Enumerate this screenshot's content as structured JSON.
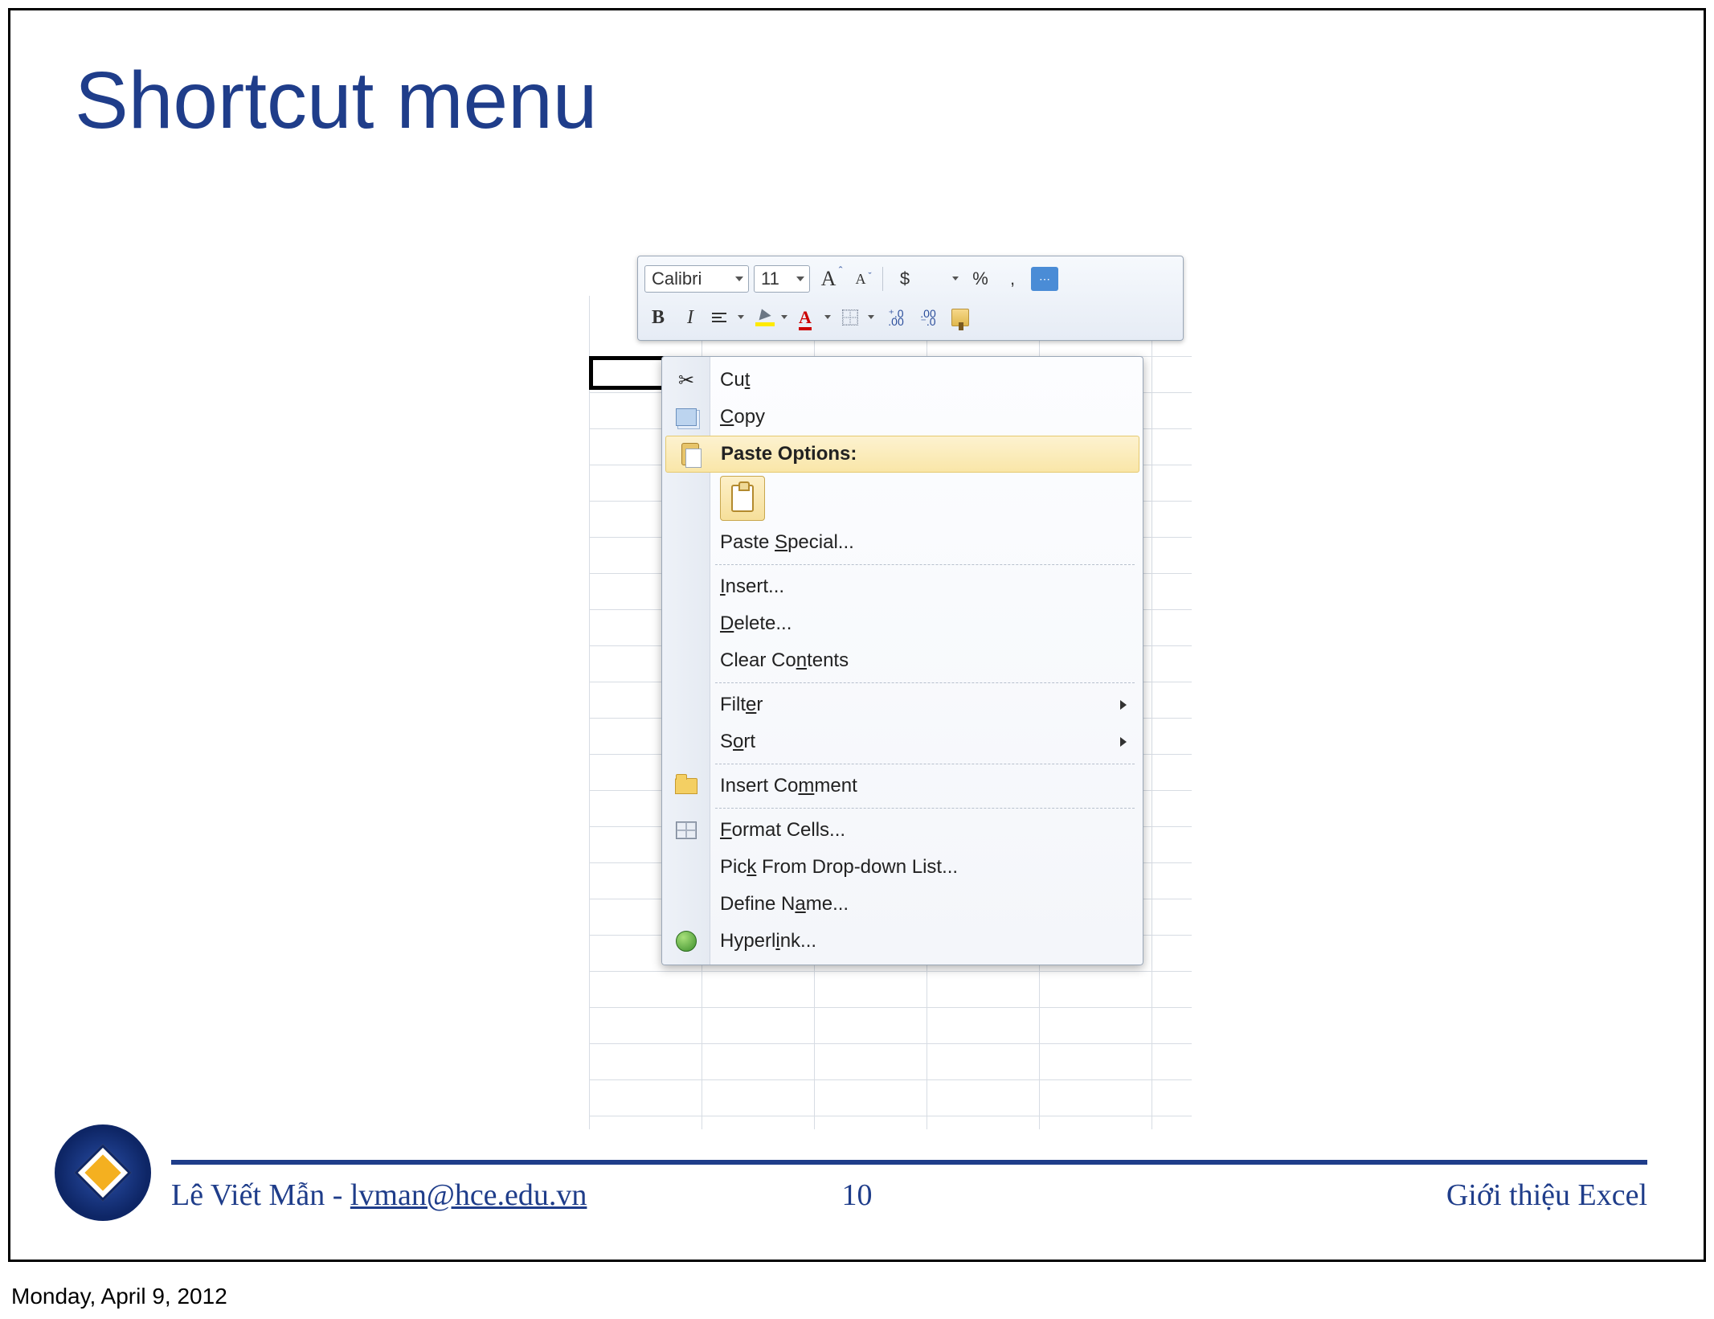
{
  "slide": {
    "title": "Shortcut menu",
    "page_number": "10",
    "topic": "Giới thiệu Excel",
    "author_line_prefix": "Lê Viết Mẫn - ",
    "author_email": "lvman@hce.edu.vn"
  },
  "timestamp": "Monday, April 9, 2012",
  "mini_toolbar": {
    "font_name": "Calibri",
    "font_size": "11",
    "currency_symbol": "$",
    "percent_symbol": "%",
    "comma_symbol": ",",
    "bold_label": "B",
    "italic_label": "I",
    "increase_decimal": ".0 →.00",
    "decrease_decimal": ".00 →.0"
  },
  "context_menu": {
    "items": [
      {
        "id": "cut",
        "label_html": "Cu<u>t</u>",
        "icon": "cut"
      },
      {
        "id": "copy",
        "label_html": "<u>C</u>opy",
        "icon": "copy"
      },
      {
        "id": "paste-options-header",
        "label_html": "Paste Options:",
        "icon": "paste",
        "header": true,
        "highlight": true
      },
      {
        "id": "paste-special",
        "label_html": "Paste <u>S</u>pecial..."
      },
      {
        "id": "insert",
        "label_html": "<u>I</u>nsert..."
      },
      {
        "id": "delete",
        "label_html": "<u>D</u>elete..."
      },
      {
        "id": "clear-contents",
        "label_html": "Clear Co<u>n</u>tents"
      },
      {
        "id": "filter",
        "label_html": "Filt<u>e</u>r",
        "submenu": true
      },
      {
        "id": "sort",
        "label_html": "S<u>o</u>rt",
        "submenu": true
      },
      {
        "id": "insert-comment",
        "label_html": "Insert Co<u>m</u>ment",
        "icon": "folder"
      },
      {
        "id": "format-cells",
        "label_html": "<u>F</u>ormat Cells...",
        "icon": "table"
      },
      {
        "id": "pick-list",
        "label_html": "Pic<u>k</u> From Drop-down List..."
      },
      {
        "id": "define-name",
        "label_html": "Define N<u>a</u>me..."
      },
      {
        "id": "hyperlink",
        "label_html": "Hyperl<u>i</u>nk...",
        "icon": "globe"
      }
    ]
  }
}
